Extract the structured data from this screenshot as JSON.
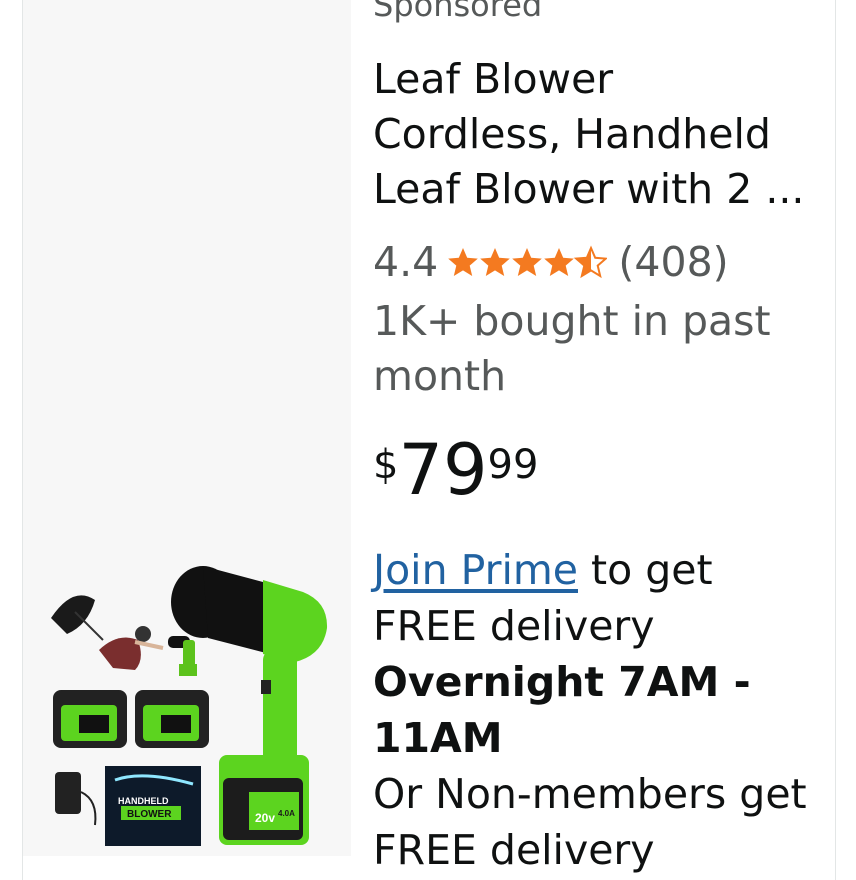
{
  "listing": {
    "sponsored_label": "Sponsored",
    "title_lines": [
      "Leaf Blower",
      "Cordless, Handheld",
      "Leaf Blower with 2 ..."
    ],
    "rating": {
      "value": "4.4",
      "stars": 4.5,
      "count": "(408)"
    },
    "bought": "1K+ bought in past month",
    "price": {
      "symbol": "$",
      "whole": "79",
      "fraction": "99"
    },
    "delivery": {
      "prime_link": "Join Prime",
      "prime_suffix": " to get FREE delivery",
      "window": "Overnight 7AM - 11AM",
      "nonmember": "Or Non-members get FREE delivery"
    },
    "image_text": {
      "box_line1": "HANDHELD",
      "box_line2": "BLOWER",
      "battery_voltage": "20v",
      "battery_capacity": "4.0A"
    }
  },
  "colors": {
    "star": "#f47a20",
    "link": "#2162a1",
    "muted": "#565959",
    "product_green": "#66cc22"
  }
}
